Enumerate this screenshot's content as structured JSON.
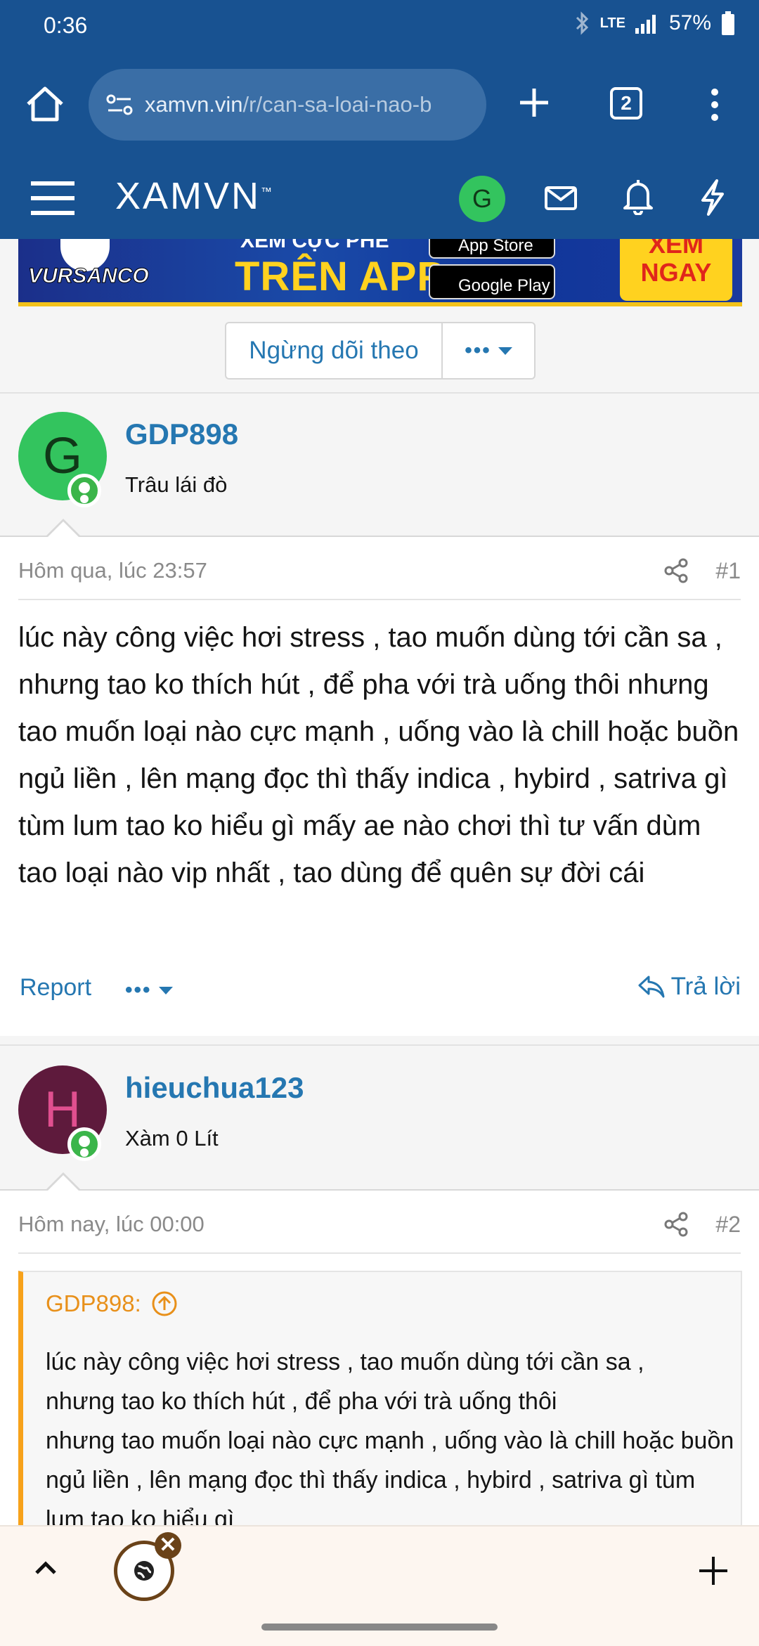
{
  "status": {
    "time": "0:36",
    "network": "LTE",
    "battery": "57%"
  },
  "browser": {
    "url_domain": "xamvn.vin",
    "url_path": "/r/can-sa-loai-nao-b",
    "tab_count": "2"
  },
  "site": {
    "logo": "XAMVN",
    "logo_mark": "™",
    "user_initial": "G"
  },
  "banner": {
    "brand": "VURSANCO",
    "top_line": "XEM CỰC PHÊ",
    "main_line": "TRÊN APP",
    "store_1": "App Store",
    "store_2": "Google Play",
    "cta_1": "XEM",
    "cta_2": "NGAY"
  },
  "thread_tools": {
    "follow_label": "Ngừng dõi theo",
    "more_label": "•••"
  },
  "posts": [
    {
      "avatar_initial": "G",
      "avatar_color": "#33c45e",
      "username": "GDP898",
      "user_title": "Trâu lái đò",
      "date": "Hôm qua, lúc 23:57",
      "number": "#1",
      "body": "lúc này công việc hơi stress , tao muốn dùng tới cần sa , nhưng tao ko thích hút , để pha với trà uống thôi nhưng tao muốn loại nào cực mạnh , uống vào là chill hoặc buồn ngủ liền , lên mạng đọc thì thấy indica , hybird , satriva gì tùm lum tao ko hiểu gì mấy ae nào chơi thì tư vấn dùm tao loại nào vip nhất , tao dùng để quên sự đời cái",
      "report_label": "Report",
      "more_label": "•••",
      "reply_label": "Trả lời"
    },
    {
      "avatar_initial": "H",
      "avatar_color": "#5e1a3c",
      "username": "hieuchua123",
      "user_title": "Xàm 0 Lít",
      "date": "Hôm nay, lúc 00:00",
      "number": "#2",
      "quote_author": "GDP898:",
      "quote_text": "lúc này công việc hơi stress , tao muốn dùng tới cần sa ,\nnhưng tao ko thích hút , để pha với trà uống thôi\nnhưng tao muốn loại nào cực mạnh , uống vào là chill hoặc buồn ngủ liền , lên mạng đọc thì thấy indica , hybird , satriva gì tùm lum tao ko hiểu gì"
    }
  ],
  "bottom_nav": {
    "close_glyph": "✕"
  }
}
